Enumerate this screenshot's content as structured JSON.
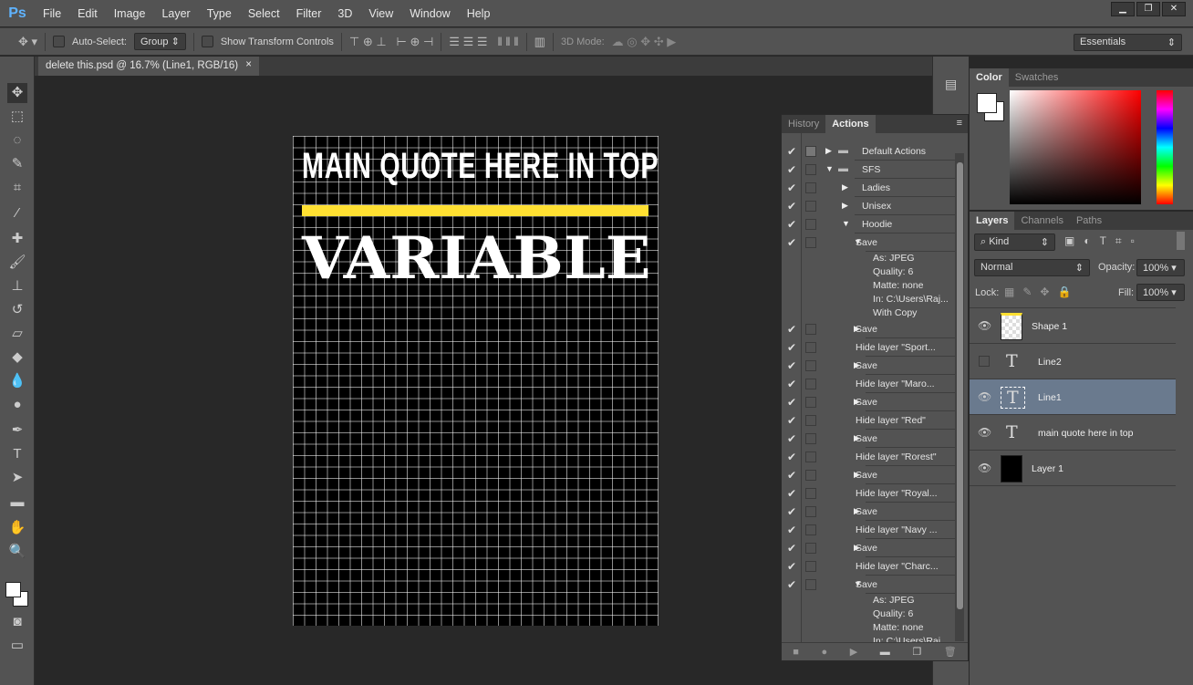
{
  "app": {
    "logo": "Ps",
    "menu": [
      "File",
      "Edit",
      "Image",
      "Layer",
      "Type",
      "Select",
      "Filter",
      "3D",
      "View",
      "Window",
      "Help"
    ],
    "window_buttons": [
      "minimize",
      "restore",
      "close"
    ]
  },
  "options": {
    "auto_select_label": "Auto-Select:",
    "auto_select_value": "Group",
    "show_transform_label": "Show Transform Controls",
    "mode_3d_label": "3D Mode:",
    "workspace": "Essentials"
  },
  "document": {
    "tab_title": "delete this.psd @ 16.7% (Line1, RGB/16)",
    "quote_text": "MAIN QUOTE HERE IN TOP",
    "variable_text": "VARIABLE",
    "bar_color": "#ffe032"
  },
  "tools": [
    "move",
    "marquee",
    "lasso",
    "quick-select",
    "crop",
    "eyedropper",
    "healing",
    "brush",
    "stamp",
    "history-brush",
    "eraser",
    "paint-bucket",
    "blur",
    "dodge",
    "pen",
    "type",
    "path-select",
    "rectangle",
    "hand",
    "zoom"
  ],
  "actions_panel": {
    "tabs": [
      "History",
      "Actions"
    ],
    "active_tab": "Actions",
    "rows": [
      {
        "label": "Default Actions",
        "level": 0,
        "kind": "set",
        "state": "collapsed",
        "dialog": true
      },
      {
        "label": "SFS",
        "level": 0,
        "kind": "set",
        "state": "expanded"
      },
      {
        "label": "Ladies",
        "level": 1,
        "state": "collapsed"
      },
      {
        "label": "Unisex",
        "level": 1,
        "state": "collapsed"
      },
      {
        "label": "Hoodie",
        "level": 1,
        "state": "expanded"
      },
      {
        "label": "Save",
        "level": 2,
        "state": "expanded"
      },
      {
        "label": "As: JPEG",
        "level": 3,
        "kind": "detail"
      },
      {
        "label": "Quality: 6",
        "level": 3,
        "kind": "detail"
      },
      {
        "label": "Matte: none",
        "level": 3,
        "kind": "detail"
      },
      {
        "label": "In: C:\\Users\\Raj...",
        "level": 3,
        "kind": "detail"
      },
      {
        "label": "With Copy",
        "level": 3,
        "kind": "detail"
      },
      {
        "label": "Save",
        "level": 2,
        "state": "collapsed"
      },
      {
        "label": "Hide layer \"Sport...",
        "level": 2
      },
      {
        "label": "Save",
        "level": 2,
        "state": "collapsed"
      },
      {
        "label": "Hide layer \"Maro...",
        "level": 2
      },
      {
        "label": "Save",
        "level": 2,
        "state": "collapsed"
      },
      {
        "label": "Hide layer \"Red\"",
        "level": 2
      },
      {
        "label": "Save",
        "level": 2,
        "state": "collapsed"
      },
      {
        "label": "Hide layer \"Rorest\"",
        "level": 2
      },
      {
        "label": "Save",
        "level": 2,
        "state": "collapsed"
      },
      {
        "label": "Hide layer \"Royal...",
        "level": 2
      },
      {
        "label": "Save",
        "level": 2,
        "state": "collapsed"
      },
      {
        "label": "Hide layer \"Navy ...",
        "level": 2
      },
      {
        "label": "Save",
        "level": 2,
        "state": "collapsed"
      },
      {
        "label": "Hide layer \"Charc...",
        "level": 2
      },
      {
        "label": "Save",
        "level": 2,
        "state": "expanded"
      },
      {
        "label": "As: JPEG",
        "level": 3,
        "kind": "detail"
      },
      {
        "label": "Quality: 6",
        "level": 3,
        "kind": "detail"
      },
      {
        "label": "Matte: none",
        "level": 3,
        "kind": "detail"
      },
      {
        "label": "In: C:\\Users\\Raj...",
        "level": 3,
        "kind": "detail"
      }
    ]
  },
  "color_panel": {
    "tabs": [
      "Color",
      "Swatches"
    ],
    "active_tab": "Color",
    "foreground": "#ffffff",
    "background": "#ffffff"
  },
  "layers_panel": {
    "tabs": [
      "Layers",
      "Channels",
      "Paths"
    ],
    "active_tab": "Layers",
    "filter": "Kind",
    "blend_mode": "Normal",
    "opacity_label": "Opacity:",
    "opacity": "100%",
    "lock_label": "Lock:",
    "fill_label": "Fill:",
    "fill": "100%",
    "layers": [
      {
        "name": "Shape 1",
        "type": "shape",
        "visible": true
      },
      {
        "name": "Line2",
        "type": "text",
        "visible": false
      },
      {
        "name": "Line1",
        "type": "text",
        "visible": true,
        "selected": true
      },
      {
        "name": "main quote here in top",
        "type": "text",
        "visible": true
      },
      {
        "name": "Layer 1",
        "type": "pixel",
        "visible": true
      }
    ]
  }
}
